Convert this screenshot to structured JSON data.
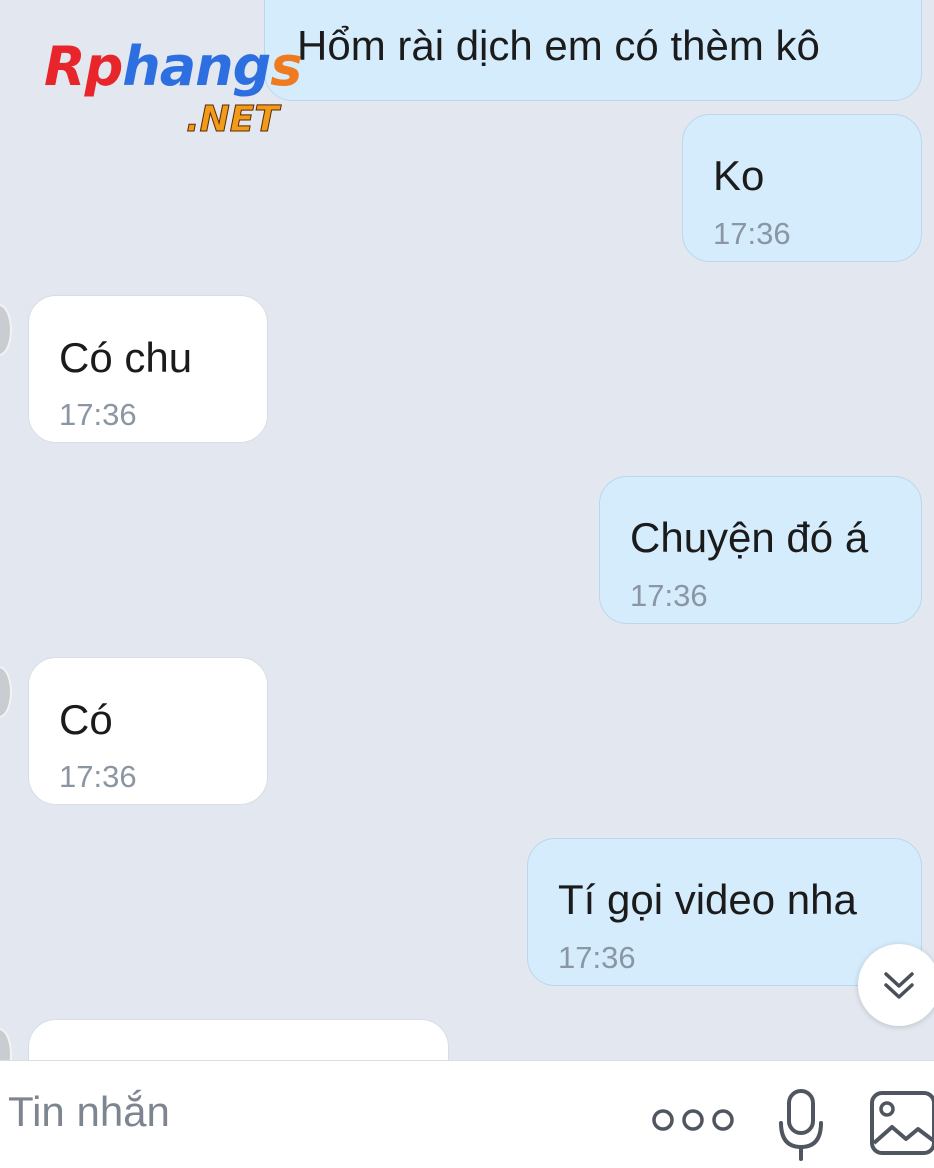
{
  "watermark": {
    "brand_name": "Rphangs",
    "suffix": ".NET"
  },
  "messages": [
    {
      "direction": "outgoing",
      "text": "Hổm rài dịch em có thèm kô",
      "time": ""
    },
    {
      "direction": "outgoing",
      "text": "Ko",
      "time": "17:36"
    },
    {
      "direction": "incoming",
      "text": "Có chu",
      "time": "17:36"
    },
    {
      "direction": "outgoing",
      "text": "Chuyện đó á",
      "time": "17:36"
    },
    {
      "direction": "incoming",
      "text": "Có",
      "time": "17:36"
    },
    {
      "direction": "outgoing",
      "text": "Tí gọi video nha",
      "time": "17:36"
    },
    {
      "direction": "incoming",
      "text": "",
      "time": ""
    }
  ],
  "composer": {
    "placeholder": "Tin nhắn",
    "icons": [
      "more-icon",
      "microphone-icon",
      "image-icon"
    ]
  },
  "scroll_button": {
    "icon": "double-chevron-down-icon"
  },
  "colors": {
    "outgoing_bubble": "#d5ecfd",
    "incoming_bubble": "#ffffff",
    "background": "#e3e8f0",
    "timestamp": "#8a96a3"
  }
}
